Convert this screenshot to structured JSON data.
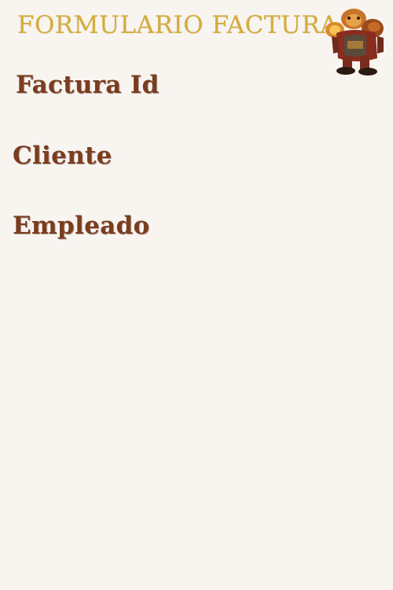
{
  "header": {
    "title": "FORMULARIO FACTURA",
    "mascot_icon": "bear-warrior-icon"
  },
  "form": {
    "fields": [
      {
        "label": "Factura Id"
      },
      {
        "label": "Cliente"
      },
      {
        "label": "Empleado"
      }
    ]
  },
  "colors": {
    "background": "#f8f5f1",
    "title": "#d6ad3b",
    "label": "#7a3d1f"
  }
}
